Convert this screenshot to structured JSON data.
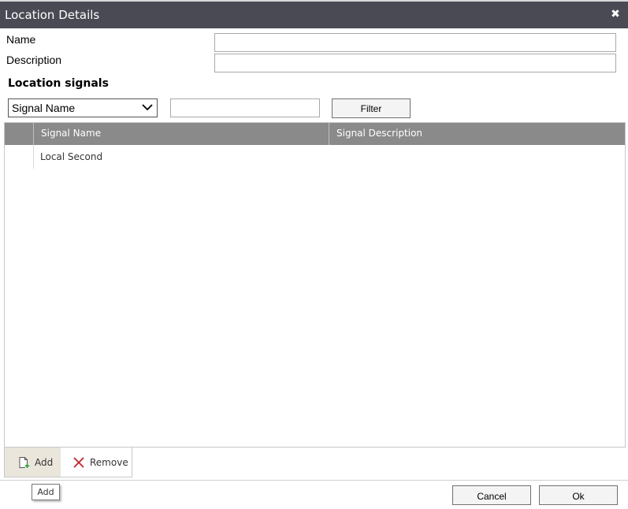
{
  "window": {
    "title": "Location Details",
    "close_icon": "close-icon"
  },
  "form": {
    "name_label": "Name",
    "name_value": "",
    "description_label": "Description",
    "description_value": ""
  },
  "signals": {
    "section_title": "Location signals",
    "filter_field_selected": "Signal Name",
    "filter_value": "",
    "filter_button": "Filter"
  },
  "grid": {
    "columns": [
      "Signal Name",
      "Signal Description"
    ],
    "rows": [
      {
        "signal_name": "Local Second",
        "signal_description": ""
      }
    ]
  },
  "toolbar": {
    "add_label": "Add",
    "remove_label": "Remove"
  },
  "tooltip": {
    "text": "Add"
  },
  "footer": {
    "cancel_label": "Cancel",
    "ok_label": "Ok"
  },
  "colors": {
    "titlebar": "#4a4a55",
    "grid_header": "#8a8a8a",
    "add_icon_accent": "#2e9e3c",
    "remove_icon": "#c0262d"
  }
}
